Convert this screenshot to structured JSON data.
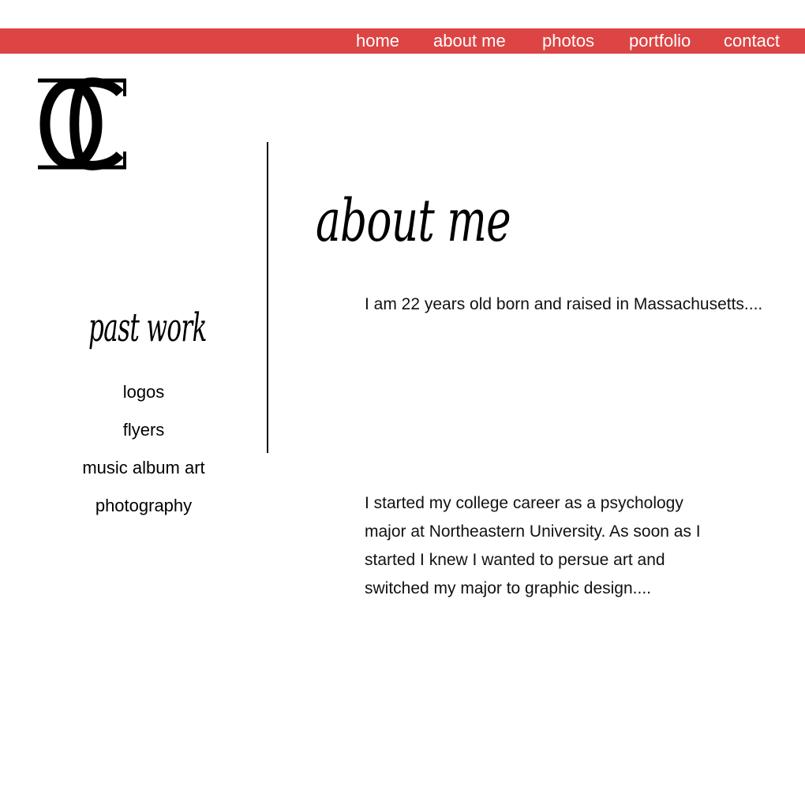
{
  "nav": {
    "items": [
      "home",
      "about me",
      "photos",
      "portfolio",
      "contact"
    ],
    "bar_color": "#dd4444",
    "text_color": "#ffffff"
  },
  "logo": {
    "icon": "oc-monogram-logo",
    "letters": "OC"
  },
  "main": {
    "title": "about me",
    "paragraphs": [
      "I am 22 years old born and raised in Massachusetts....",
      "I started my college career as a psychology major at Northeastern University.  As soon as I started I knew I wanted to persue art and switched my major to graphic design...."
    ]
  },
  "sidebar": {
    "title": "past work",
    "links": [
      "logos",
      "flyers",
      "music album art",
      "photography"
    ]
  }
}
